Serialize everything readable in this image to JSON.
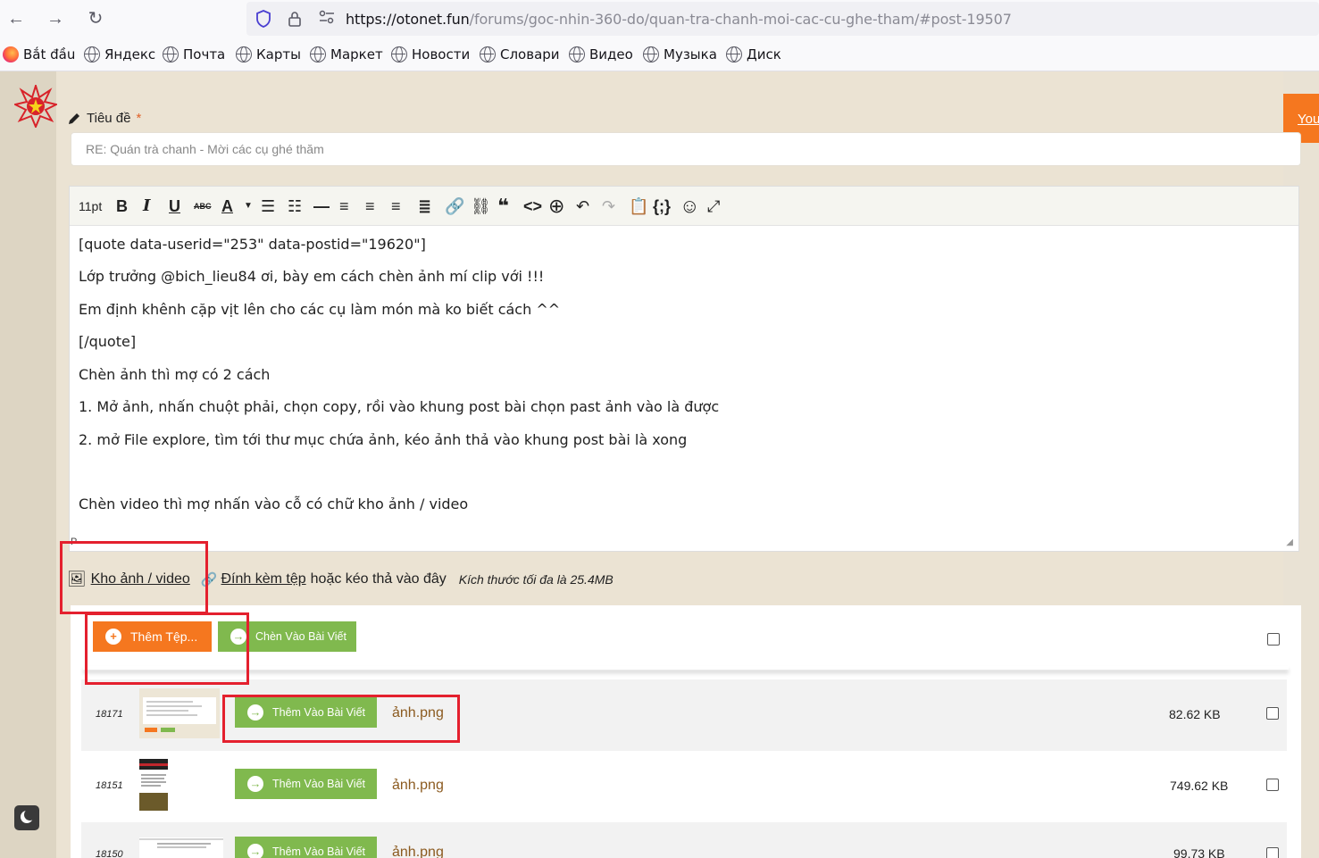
{
  "browser": {
    "url_host": "https://otonet.fun",
    "url_path": "/forums/goc-nhin-360-do/quan-tra-chanh-moi-cac-cu-ghe-tham/#post-19507",
    "bookmarks": [
      {
        "label": "Bắt đầu",
        "icon": "firefox-icon"
      },
      {
        "label": "Яндекс",
        "icon": "globe-icon"
      },
      {
        "label": "Почта",
        "icon": "globe-icon"
      },
      {
        "label": "Карты",
        "icon": "globe-icon"
      },
      {
        "label": "Маркет",
        "icon": "globe-icon"
      },
      {
        "label": "Новости",
        "icon": "globe-icon"
      },
      {
        "label": "Словари",
        "icon": "globe-icon"
      },
      {
        "label": "Видео",
        "icon": "globe-icon"
      },
      {
        "label": "Музыка",
        "icon": "globe-icon"
      },
      {
        "label": "Диск",
        "icon": "globe-icon"
      }
    ]
  },
  "form": {
    "title_label": "Tiêu đề",
    "required_mark": "*",
    "title_value": "RE: Quán trà chanh - Mời các cụ ghé thăm",
    "font_size": "11pt"
  },
  "editor": {
    "lines": [
      "[quote data-userid=\"253\" data-postid=\"19620\"]",
      "Lớp trưởng @bich_lieu84 ơi, bày em cách chèn ảnh mí clip với !!!",
      "Em định khênh cặp vịt lên cho các cụ làm món mà ko biết cách ^^",
      "[/quote]",
      "Chèn ảnh thì mợ có 2 cách",
      "1. Mở ảnh, nhấn chuột phải, chọn copy, rồi vào khung post bài chọn past ảnh vào là được",
      "2. mở File explore, tìm tới thư mục chứa ảnh, kéo ảnh thả vào khung post bài là xong",
      "Chèn video thì mợ nhấn vào cỗ có chữ kho ảnh / video"
    ],
    "path_tag": "P"
  },
  "attachments": {
    "gallery_link": "Kho ảnh / video",
    "attach_link": "Đính kèm tệp",
    "attach_suffix": "hoặc kéo thả vào đây",
    "max_size_hint": "Kích thước tối đa là 25.4MB",
    "add_files_button": "Thêm Tệp...",
    "insert_button": "Chèn Vào Bài Viết",
    "add_to_post_label": "Thêm Vào Bài Viết",
    "files": [
      {
        "id": "18171",
        "name": "ảnh.png",
        "size": "82.62 KB"
      },
      {
        "id": "18151",
        "name": "ảnh.png",
        "size": "749.62 KB"
      },
      {
        "id": "18150",
        "name": "ảnh.png",
        "size": "99.73 KB"
      }
    ]
  },
  "side_tab": "You",
  "colors": {
    "accent": "#f5771f",
    "green": "#80b94e",
    "highlight": "#e4202e"
  }
}
